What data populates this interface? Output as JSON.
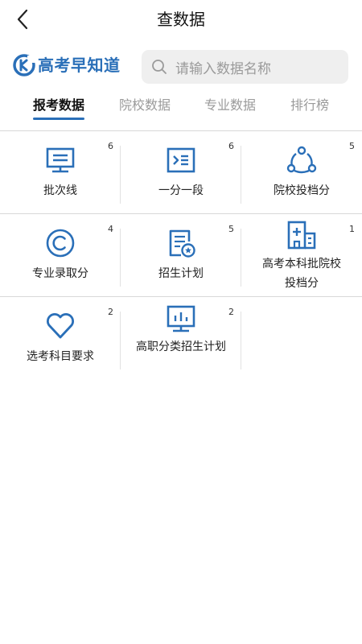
{
  "header": {
    "title": "查数据"
  },
  "brand": {
    "name": "高考早知道"
  },
  "search": {
    "placeholder": "请输入数据名称"
  },
  "tabs": [
    {
      "label": "报考数据",
      "active": true
    },
    {
      "label": "院校数据",
      "active": false
    },
    {
      "label": "专业数据",
      "active": false
    },
    {
      "label": "排行榜",
      "active": false
    }
  ],
  "colors": {
    "accent": "#2a6fb8"
  },
  "items": [
    {
      "label": "批次线",
      "count": "6",
      "icon": "monitor-icon"
    },
    {
      "label": "一分一段",
      "count": "6",
      "icon": "terminal-icon"
    },
    {
      "label": "院校投档分",
      "count": "5",
      "icon": "share-nodes-icon"
    },
    {
      "label": "专业录取分",
      "count": "4",
      "icon": "copyright-icon"
    },
    {
      "label": "招生计划",
      "count": "5",
      "icon": "document-star-icon"
    },
    {
      "label": "高考本科批院校投档分",
      "count": "1",
      "icon": "hospital-building-icon"
    },
    {
      "label": "选考科目要求",
      "count": "2",
      "icon": "heart-icon"
    },
    {
      "label": "高职分类招生计划",
      "count": "2",
      "icon": "chart-board-icon"
    }
  ]
}
